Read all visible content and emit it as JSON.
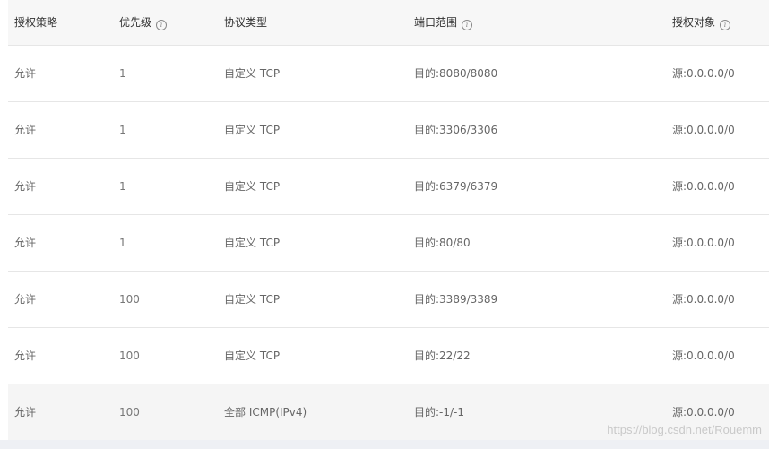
{
  "table": {
    "columns": [
      {
        "label": "授权策略",
        "has_info": false
      },
      {
        "label": "优先级",
        "has_info": true
      },
      {
        "label": "协议类型",
        "has_info": false
      },
      {
        "label": "端口范围",
        "has_info": true
      },
      {
        "label": "授权对象",
        "has_info": true
      }
    ],
    "rows": [
      {
        "policy": "允许",
        "priority": "1",
        "protocol": "自定义 TCP",
        "port": "目的:8080/8080",
        "source": "源:0.0.0.0/0"
      },
      {
        "policy": "允许",
        "priority": "1",
        "protocol": "自定义 TCP",
        "port": "目的:3306/3306",
        "source": "源:0.0.0.0/0"
      },
      {
        "policy": "允许",
        "priority": "1",
        "protocol": "自定义 TCP",
        "port": "目的:6379/6379",
        "source": "源:0.0.0.0/0"
      },
      {
        "policy": "允许",
        "priority": "1",
        "protocol": "自定义 TCP",
        "port": "目的:80/80",
        "source": "源:0.0.0.0/0"
      },
      {
        "policy": "允许",
        "priority": "100",
        "protocol": "自定义 TCP",
        "port": "目的:3389/3389",
        "source": "源:0.0.0.0/0"
      },
      {
        "policy": "允许",
        "priority": "100",
        "protocol": "自定义 TCP",
        "port": "目的:22/22",
        "source": "源:0.0.0.0/0"
      },
      {
        "policy": "允许",
        "priority": "100",
        "protocol": "全部 ICMP(IPv4)",
        "port": "目的:-1/-1",
        "source": "源:0.0.0.0/0"
      }
    ]
  },
  "info_icon_glyph": "i",
  "watermark": "https://blog.csdn.net/Rouemm",
  "colors": {
    "header_bg": "#f7f7f7",
    "border": "#e6e6e6",
    "last_row_bg": "#f5f5f5"
  }
}
